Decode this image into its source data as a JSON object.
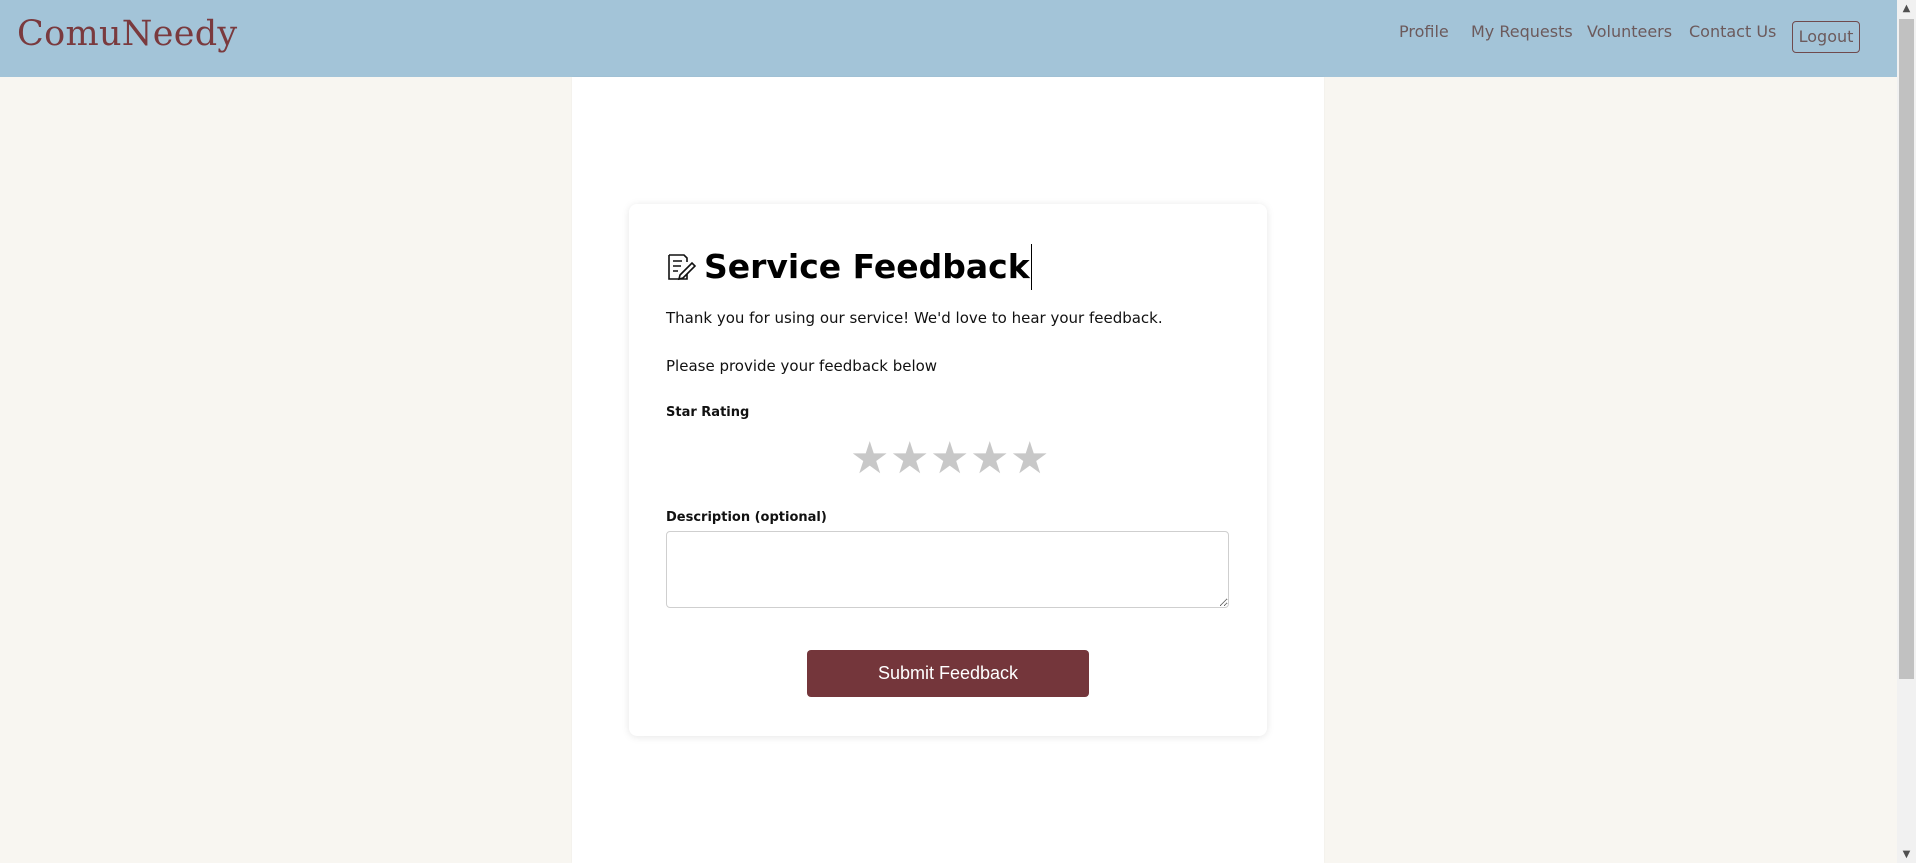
{
  "navbar": {
    "brand": "ComuNeedy",
    "links": [
      "Profile",
      "My Requests",
      "Volunteers",
      "Contact Us"
    ],
    "logout_label": "Logout",
    "background_color": "#a3c4d8",
    "brand_color": "#7a3a3e"
  },
  "feedback": {
    "icon": "edit-note-icon",
    "title": "Service Feedback",
    "thanks_text": "Thank you for using our service! We'd love to hear your feedback.",
    "prompt_text": "Please provide your feedback below",
    "rating_label": "Star Rating",
    "rating_value": 0,
    "rating_max": 5,
    "description_label": "Description (optional)",
    "description_value": "",
    "submit_label": "Submit Feedback",
    "submit_color": "#74363b"
  },
  "scrollbar": {
    "up_icon": "scroll-up-arrow-icon",
    "down_icon": "scroll-down-arrow-icon"
  }
}
